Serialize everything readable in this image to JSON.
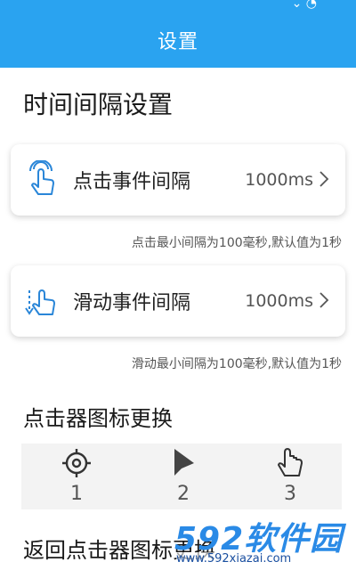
{
  "header": {
    "title": "设置"
  },
  "sections": {
    "interval_title": "时间间隔设置",
    "icon_title": "点击器图标更换",
    "cut_title": "返回点击器图标更换"
  },
  "click_card": {
    "label": "点击事件间隔",
    "value": "1000ms",
    "icon": "tap-hand-icon",
    "hint": "点击最小间隔为100毫秒,默认值为1秒"
  },
  "swipe_card": {
    "label": "滑动事件间隔",
    "value": "1000ms",
    "icon": "swipe-hand-icon",
    "hint": "滑动最小间隔为100毫秒,默认值为1秒"
  },
  "pickers": [
    {
      "number": "1",
      "icon": "crosshair-icon"
    },
    {
      "number": "2",
      "icon": "pointer-arrow-icon"
    },
    {
      "number": "3",
      "icon": "hand-pointer-icon"
    }
  ],
  "watermark": {
    "brand": "592软件园",
    "url": "www.592xiazai.com"
  },
  "colors": {
    "accent": "#2aa3f0",
    "icon_blue": "#2a86d8"
  }
}
